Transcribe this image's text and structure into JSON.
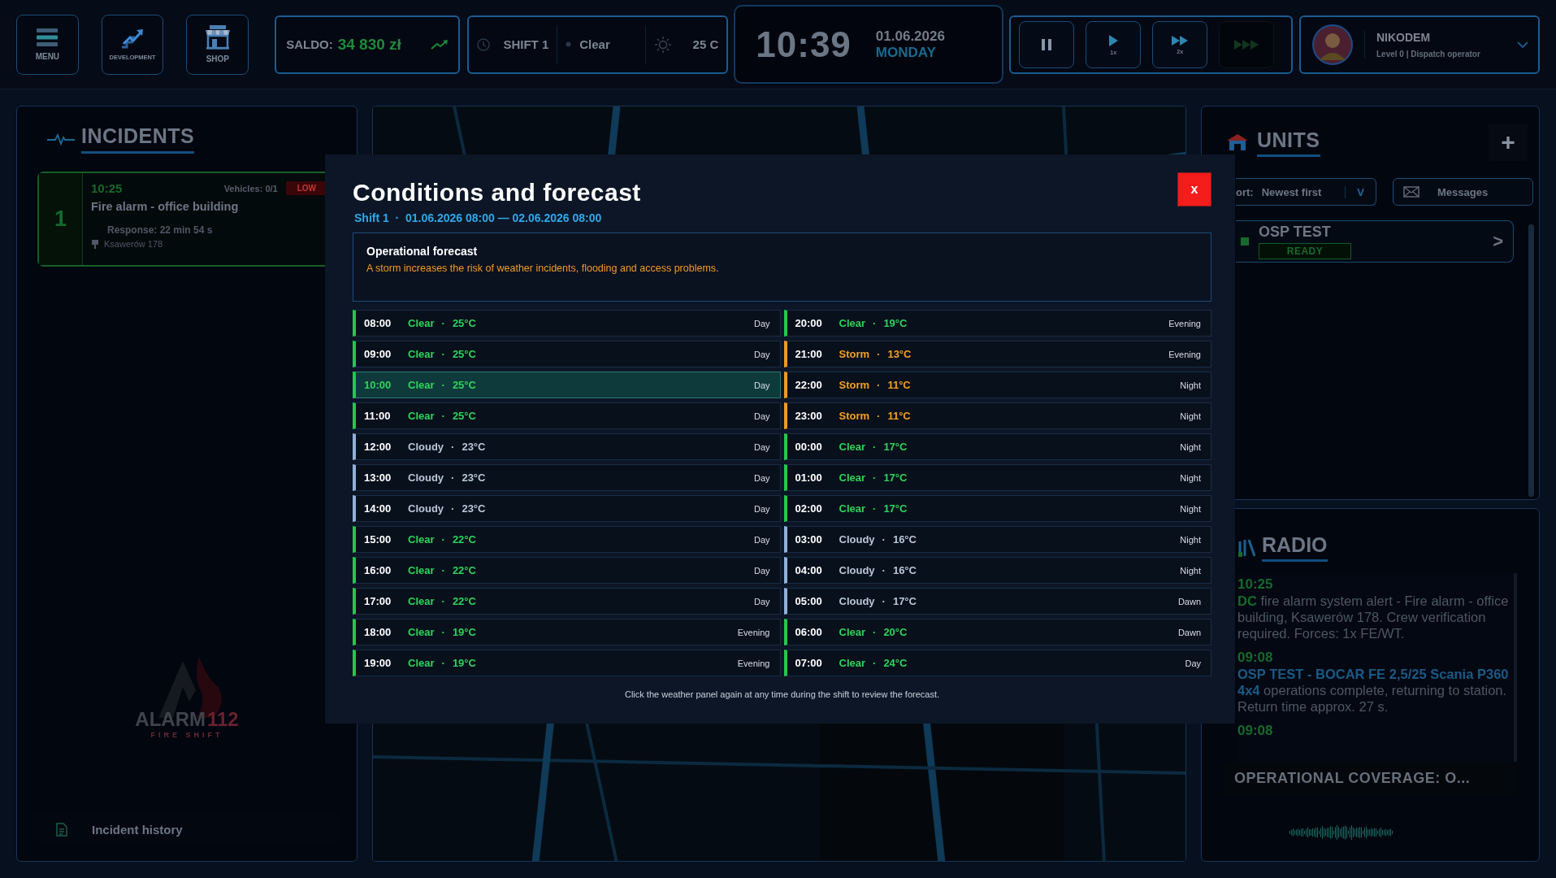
{
  "topbar": {
    "buttons": [
      {
        "label": "MENU",
        "kind": "menu"
      },
      {
        "label": "DEVELOPMENT",
        "kind": "development"
      },
      {
        "label": "SHOP",
        "kind": "shop"
      }
    ],
    "balance": {
      "label": "SALDO:",
      "value": "34 830 zł"
    },
    "shift": {
      "label": "SHIFT 1",
      "weather": "Clear",
      "temperature": "25 C"
    },
    "clock": {
      "time": "10:39",
      "date": "01.06.2026",
      "weekday": "MONDAY"
    },
    "speed": [
      {
        "kind": "pause",
        "disabled": false
      },
      {
        "kind": "play",
        "label": "1x",
        "disabled": false
      },
      {
        "kind": "fast",
        "label": "2x",
        "disabled": false
      },
      {
        "kind": "fastest",
        "disabled": true
      }
    ],
    "user": {
      "name": "NIKODEM",
      "role": "Level 0 | Dispatch operator"
    }
  },
  "incidents": {
    "title": "INCIDENTS",
    "items": [
      {
        "number": "1",
        "time": "10:25",
        "vehicles": "Vehicles: 0/1",
        "priority": "LOW",
        "title": "Fire alarm - office building",
        "response": "Response: 22 min 54 s",
        "address": "Ksawerów 178"
      }
    ],
    "logo": {
      "name": "ALARM",
      "number": "112",
      "tagline": "FIRE SHIFT"
    },
    "history": "Incident history"
  },
  "units": {
    "title": "UNITS",
    "add": "+",
    "sort_label": "ort:",
    "sort_value": "Newest first",
    "sort_caret": "V",
    "messages": "Messages",
    "items": [
      {
        "name": "OSP TEST",
        "status": "READY",
        "open": ">"
      }
    ]
  },
  "radio": {
    "title": "RADIO",
    "entries": [
      {
        "time": "10:25",
        "kind": "dispatch",
        "message": "**DC** fire alarm system alert - Fire alarm - office building, Ksawerów 178. Crew verification required. Forces: 1x FE/WT."
      },
      {
        "time": "09:08",
        "kind": "unit",
        "message": "**OSP TEST - BOCAR FE 2,5/25 Scania P360 4x4** operations complete, returning to station. Return time approx. 27 s."
      },
      {
        "time": "09:08"
      }
    ],
    "coverage": "OPERATIONAL COVERAGE: O..."
  },
  "modal": {
    "title": "Conditions and forecast",
    "close": "x",
    "subtitle": "Shift 1  ·  01.06.2026 08:00 — 02.06.2026 08:00",
    "forecast": {
      "title": "Operational forecast",
      "text": "A storm increases the risk of weather incidents, flooding and access problems."
    },
    "separator": "·",
    "columns": [
      [
        {
          "time": "08:00",
          "condition": "Clear",
          "temperature": "25°C",
          "period": "Day",
          "kind": "clear",
          "selected": false
        },
        {
          "time": "09:00",
          "condition": "Clear",
          "temperature": "25°C",
          "period": "Day",
          "kind": "clear",
          "selected": false
        },
        {
          "time": "10:00",
          "condition": "Clear",
          "temperature": "25°C",
          "period": "Day",
          "kind": "clear",
          "selected": true
        },
        {
          "time": "11:00",
          "condition": "Clear",
          "temperature": "25°C",
          "period": "Day",
          "kind": "clear",
          "selected": false
        },
        {
          "time": "12:00",
          "condition": "Cloudy",
          "temperature": "23°C",
          "period": "Day",
          "kind": "cloudy",
          "selected": false
        },
        {
          "time": "13:00",
          "condition": "Cloudy",
          "temperature": "23°C",
          "period": "Day",
          "kind": "cloudy",
          "selected": false
        },
        {
          "time": "14:00",
          "condition": "Cloudy",
          "temperature": "23°C",
          "period": "Day",
          "kind": "cloudy",
          "selected": false
        },
        {
          "time": "15:00",
          "condition": "Clear",
          "temperature": "22°C",
          "period": "Day",
          "kind": "clear",
          "selected": false
        },
        {
          "time": "16:00",
          "condition": "Clear",
          "temperature": "22°C",
          "period": "Day",
          "kind": "clear",
          "selected": false
        },
        {
          "time": "17:00",
          "condition": "Clear",
          "temperature": "22°C",
          "period": "Day",
          "kind": "clear",
          "selected": false
        },
        {
          "time": "18:00",
          "condition": "Clear",
          "temperature": "19°C",
          "period": "Evening",
          "kind": "clear",
          "selected": false
        },
        {
          "time": "19:00",
          "condition": "Clear",
          "temperature": "19°C",
          "period": "Evening",
          "kind": "clear",
          "selected": false
        }
      ],
      [
        {
          "time": "20:00",
          "condition": "Clear",
          "temperature": "19°C",
          "period": "Evening",
          "kind": "clear",
          "selected": false
        },
        {
          "time": "21:00",
          "condition": "Storm",
          "temperature": "13°C",
          "period": "Evening",
          "kind": "storm",
          "selected": false
        },
        {
          "time": "22:00",
          "condition": "Storm",
          "temperature": "11°C",
          "period": "Night",
          "kind": "storm",
          "selected": false
        },
        {
          "time": "23:00",
          "condition": "Storm",
          "temperature": "11°C",
          "period": "Night",
          "kind": "storm",
          "selected": false
        },
        {
          "time": "00:00",
          "condition": "Clear",
          "temperature": "17°C",
          "period": "Night",
          "kind": "clear",
          "selected": false
        },
        {
          "time": "01:00",
          "condition": "Clear",
          "temperature": "17°C",
          "period": "Night",
          "kind": "clear",
          "selected": false
        },
        {
          "time": "02:00",
          "condition": "Clear",
          "temperature": "17°C",
          "period": "Night",
          "kind": "clear",
          "selected": false
        },
        {
          "time": "03:00",
          "condition": "Cloudy",
          "temperature": "16°C",
          "period": "Night",
          "kind": "cloudy",
          "selected": false
        },
        {
          "time": "04:00",
          "condition": "Cloudy",
          "temperature": "16°C",
          "period": "Night",
          "kind": "cloudy",
          "selected": false
        },
        {
          "time": "05:00",
          "condition": "Cloudy",
          "temperature": "17°C",
          "period": "Dawn",
          "kind": "cloudy",
          "selected": false
        },
        {
          "time": "06:00",
          "condition": "Clear",
          "temperature": "20°C",
          "period": "Dawn",
          "kind": "clear",
          "selected": false
        },
        {
          "time": "07:00",
          "condition": "Clear",
          "temperature": "24°C",
          "period": "Day",
          "kind": "clear",
          "selected": false
        }
      ]
    ],
    "footer": "Click the weather panel again at any time during the shift to review the forecast."
  }
}
